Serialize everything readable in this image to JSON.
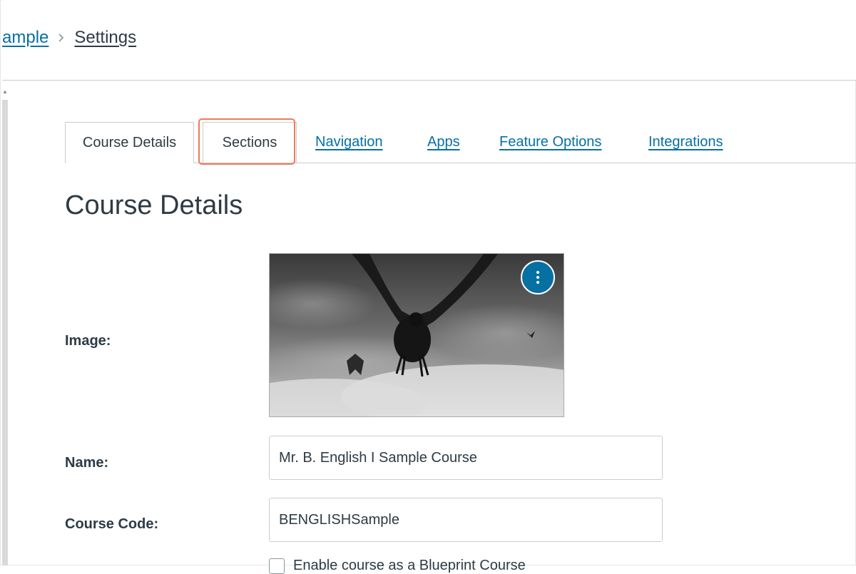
{
  "breadcrumb": {
    "parent_label": "ample",
    "current_label": "Settings"
  },
  "tabs": [
    {
      "label": "Course Details",
      "state": "active"
    },
    {
      "label": "Sections",
      "state": "highlighted"
    },
    {
      "label": "Navigation",
      "state": "link"
    },
    {
      "label": "Apps",
      "state": "link"
    },
    {
      "label": "Feature Options",
      "state": "link"
    },
    {
      "label": "Integrations",
      "state": "link"
    }
  ],
  "page_title": "Course Details",
  "form": {
    "image_label": "Image:",
    "name_label": "Name:",
    "name_value": "Mr. B. English I Sample Course",
    "course_code_label": "Course Code:",
    "course_code_value": "BENGLISHSample",
    "blueprint_checkbox_label": "Enable course as a Blueprint Course"
  },
  "icons": {
    "breadcrumb_separator": "chevron-right-icon",
    "image_options": "kebab-menu-icon"
  },
  "colors": {
    "link": "#0770a3",
    "text": "#2d3b45",
    "highlight": "#ee7b54",
    "options_button": "#0770a3"
  }
}
